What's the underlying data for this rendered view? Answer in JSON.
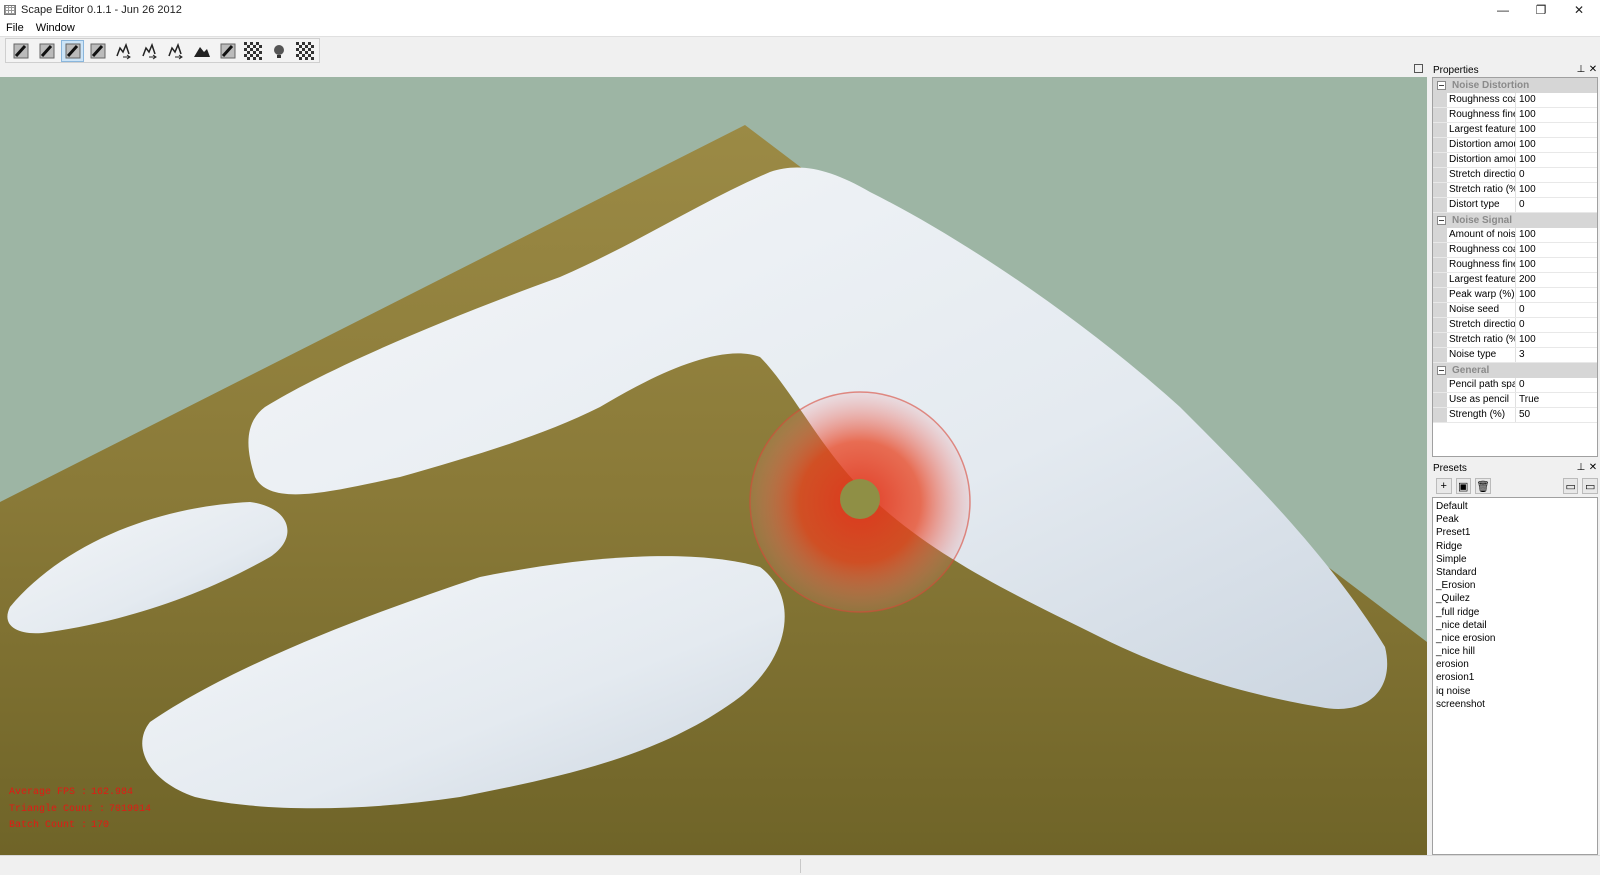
{
  "window": {
    "title": "Scape Editor 0.1.1 - Jun 26 2012",
    "min_glyph": "—",
    "max_glyph": "❐",
    "close_glyph": "✕"
  },
  "menu": {
    "items": [
      "File",
      "Window"
    ]
  },
  "toolbar": {
    "icons": [
      "brush-tool-1-icon",
      "brush-tool-2-icon",
      "brush-tool-3-icon",
      "brush-tool-4-icon",
      "export-tool-1-icon",
      "export-tool-2-icon",
      "export-tool-3-icon",
      "terrain-tool-icon",
      "brush-tool-5-icon",
      "checker-tool-1-icon",
      "light-tool-icon",
      "checker-tool-2-icon"
    ],
    "active_index": 2
  },
  "viewport": {
    "colors": {
      "sky": "#9db5a4",
      "ground": "#8d7c36",
      "snow": "#e9eef2",
      "brush": "#e0341c"
    },
    "stats": [
      {
        "label": "Average  FPS     :",
        "value": "162.984"
      },
      {
        "label": "Triangle  Count  :",
        "value": "7019014"
      },
      {
        "label": "Batch  Count     :",
        "value": "170"
      }
    ]
  },
  "properties": {
    "title": "Properties",
    "categories": [
      {
        "name": "Noise Distortion",
        "rows": [
          {
            "name": "Roughness coars",
            "value": "100"
          },
          {
            "name": "Roughness fine d",
            "value": "100"
          },
          {
            "name": "Largest feature (",
            "value": "100"
          },
          {
            "name": "Distortion amour",
            "value": "100"
          },
          {
            "name": "Distortion amour",
            "value": "100"
          },
          {
            "name": "Stretch direction",
            "value": "0"
          },
          {
            "name": "Stretch ratio (%)",
            "value": "100"
          },
          {
            "name": "Distort type",
            "value": "0"
          }
        ]
      },
      {
        "name": "Noise Signal",
        "rows": [
          {
            "name": "Amount of noise",
            "value": "100"
          },
          {
            "name": "Roughness coars",
            "value": "100"
          },
          {
            "name": "Roughness fine d",
            "value": "100"
          },
          {
            "name": "Largest feature (",
            "value": "200"
          },
          {
            "name": "Peak warp (%)",
            "value": "100"
          },
          {
            "name": "Noise seed",
            "value": "0"
          },
          {
            "name": "Stretch direction",
            "value": "0"
          },
          {
            "name": "Stretch ratio (%)",
            "value": "100"
          },
          {
            "name": "Noise type",
            "value": "3"
          }
        ]
      },
      {
        "name": "General",
        "rows": [
          {
            "name": "Pencil path spaci",
            "value": "0"
          },
          {
            "name": "Use as pencil",
            "value": "True"
          },
          {
            "name": "Strength (%)",
            "value": "50"
          }
        ]
      }
    ]
  },
  "presets": {
    "title": "Presets",
    "tool_glyphs": [
      "+",
      "▣",
      "🗑"
    ],
    "items": [
      "Default",
      "Peak",
      "Preset1",
      "Ridge",
      "Simple",
      "Standard",
      "_Erosion",
      "_Quilez",
      "_full ridge",
      "_nice detail",
      "_nice erosion",
      "_nice hill",
      "erosion",
      "erosion1",
      "iq noise",
      "screenshot"
    ]
  },
  "dock_buttons": {
    "pin": "⊥",
    "close": "✕"
  }
}
